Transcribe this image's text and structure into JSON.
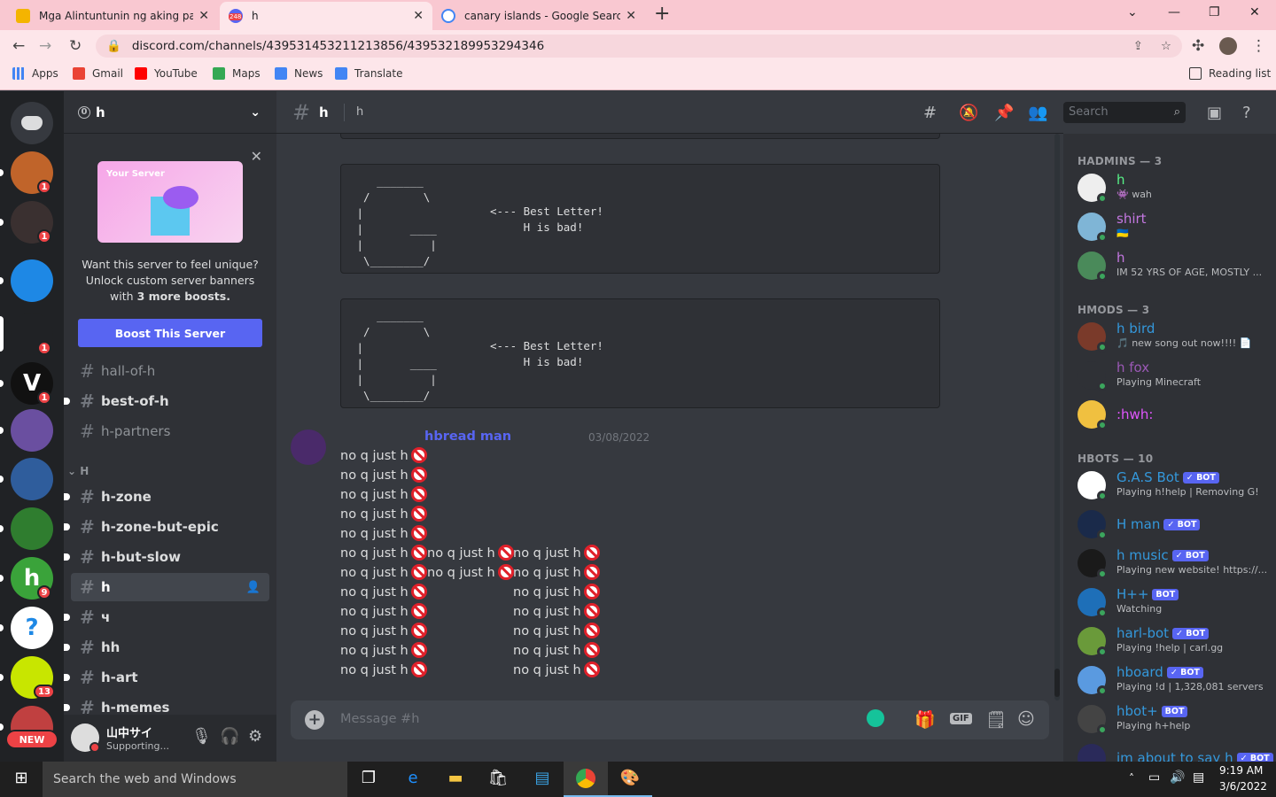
{
  "browser": {
    "tabs": [
      {
        "title": "Mga Alintuntunin ng aking paara",
        "color": "#f4b400",
        "active": false
      },
      {
        "title": "h",
        "color": "#5865f2",
        "badge": "248",
        "active": true
      },
      {
        "title": "canary islands - Google Search",
        "color": "#4285f4",
        "active": false
      }
    ],
    "new_tab": "+",
    "url": "discord.com/channels/439531453211213856/439532189953294346",
    "bookmarks": [
      "Apps",
      "Gmail",
      "YouTube",
      "Maps",
      "News",
      "Translate"
    ],
    "reading_list": "Reading list"
  },
  "guilds": [
    {
      "name": "discord-home",
      "color": "#36393f"
    },
    {
      "name": "server-1",
      "color": "#c0642a",
      "badge": "1"
    },
    {
      "name": "server-2",
      "color": "#3a3030",
      "badge": "1"
    },
    {
      "name": "server-3",
      "color": "#1e88e5"
    },
    {
      "name": "server-4",
      "color": "#202225",
      "badge": "1"
    },
    {
      "name": "server-5",
      "color": "#111111",
      "letter": "V",
      "badge": "1"
    },
    {
      "name": "server-6",
      "color": "#6a4fa0"
    },
    {
      "name": "server-7",
      "color": "#2f5d9c"
    },
    {
      "name": "server-8",
      "color": "#2f7d2f"
    },
    {
      "name": "server-9",
      "color": "#3aa33a",
      "badge": "9",
      "letter": "h"
    },
    {
      "name": "server-10",
      "color": "#ffffff",
      "letter": "?"
    },
    {
      "name": "server-11",
      "color": "#c8e600",
      "badge": "13"
    },
    {
      "name": "server-12",
      "color": "#c04040",
      "badge": "NEW"
    }
  ],
  "server": {
    "name": "h",
    "boost_badge": "0",
    "promo": {
      "banner_label": "Your Server",
      "text": "Want this server to feel unique? Unlock custom server banners with",
      "bold": "3 more boosts.",
      "button": "Boost This Server"
    },
    "channels": [
      {
        "name": "hall-of-h",
        "state": "normal"
      },
      {
        "name": "best-of-h",
        "state": "unread"
      },
      {
        "name": "h-partners",
        "state": "normal"
      }
    ],
    "category": "H",
    "category_channels": [
      {
        "name": "h-zone",
        "state": "unread"
      },
      {
        "name": "h-zone-but-epic",
        "state": "unread"
      },
      {
        "name": "h-but-slow",
        "state": "unread"
      },
      {
        "name": "h",
        "state": "selected"
      },
      {
        "name": "ч",
        "state": "unread"
      },
      {
        "name": "hh",
        "state": "unread"
      },
      {
        "name": "h-art",
        "state": "unread"
      },
      {
        "name": "h-memes",
        "state": "unread"
      }
    ]
  },
  "user": {
    "name": "山中サイ",
    "status": "Supporting..."
  },
  "chat": {
    "channel": "h",
    "topic": "h",
    "search_placeholder": "Search",
    "ascii_art": "    _______\n  /        \\\n |\n |       ____\n |          |\n  \\________/",
    "ascii_caption": "<--- Best Letter!\n     H is bad!",
    "author": "hbread man",
    "timestamp": "03/08/2022",
    "line_text": "no q just h",
    "composer_placeholder": "Message #h"
  },
  "members": {
    "categories": [
      {
        "title": "HADMINS — 3",
        "members": [
          {
            "name": "h",
            "sub": "👾 wah",
            "color": "#57f287",
            "avatar": "#eeeeee"
          },
          {
            "name": "shirt",
            "sub": "🇺🇦",
            "color": "#c377e0",
            "avatar": "#7fb5d6"
          },
          {
            "name": "h",
            "sub": "IM 52 YRS OF AGE, MOSTLY ...",
            "color": "#c377e0",
            "avatar": "#4a8a5a"
          }
        ]
      },
      {
        "title": "HMODS — 3",
        "members": [
          {
            "name": "h bird",
            "sub": "🎵 new song out now!!!! 📄",
            "color": "#3498db",
            "avatar": "#7a3a2a"
          },
          {
            "name": "h fox",
            "sub": "Playing Minecraft",
            "color": "#9b59b6",
            "avatar": "#2f3136"
          },
          {
            "name": ":hwh:",
            "sub": "",
            "color": "#e056fd",
            "avatar": "#f0c040"
          }
        ]
      },
      {
        "title": "HBOTS — 10",
        "members": [
          {
            "name": "G.A.S Bot",
            "sub": "Playing h!help | Removing G!",
            "color": "#3498db",
            "avatar": "#ffffff",
            "bot": "✓ BOT"
          },
          {
            "name": "H man",
            "sub": "",
            "color": "#3498db",
            "avatar": "#1a2a4a",
            "bot": "✓ BOT"
          },
          {
            "name": "h music",
            "sub": "Playing new website! https://...",
            "color": "#3498db",
            "avatar": "#1a1a1a",
            "bot": "✓ BOT"
          },
          {
            "name": "H++",
            "sub": "Watching",
            "color": "#3498db",
            "avatar": "#1e6fb8",
            "bot": "BOT"
          },
          {
            "name": "harl-bot",
            "sub": "Playing !help | carl.gg",
            "color": "#3498db",
            "avatar": "#6a9a3a",
            "bot": "✓ BOT"
          },
          {
            "name": "hboard",
            "sub": "Playing !d | 1,328,081 servers",
            "color": "#3498db",
            "avatar": "#5a9ae0",
            "bot": "✓ BOT"
          },
          {
            "name": "hbot+",
            "sub": "Playing h+help",
            "color": "#3498db",
            "avatar": "#444444",
            "bot": "BOT"
          },
          {
            "name": "im about to say h",
            "sub": "",
            "color": "#3498db",
            "avatar": "#2a2a5a",
            "bot": "✓ BOT"
          }
        ]
      }
    ]
  },
  "taskbar": {
    "search_placeholder": "Search the web and Windows",
    "time": "9:19 AM",
    "date": "3/6/2022"
  }
}
